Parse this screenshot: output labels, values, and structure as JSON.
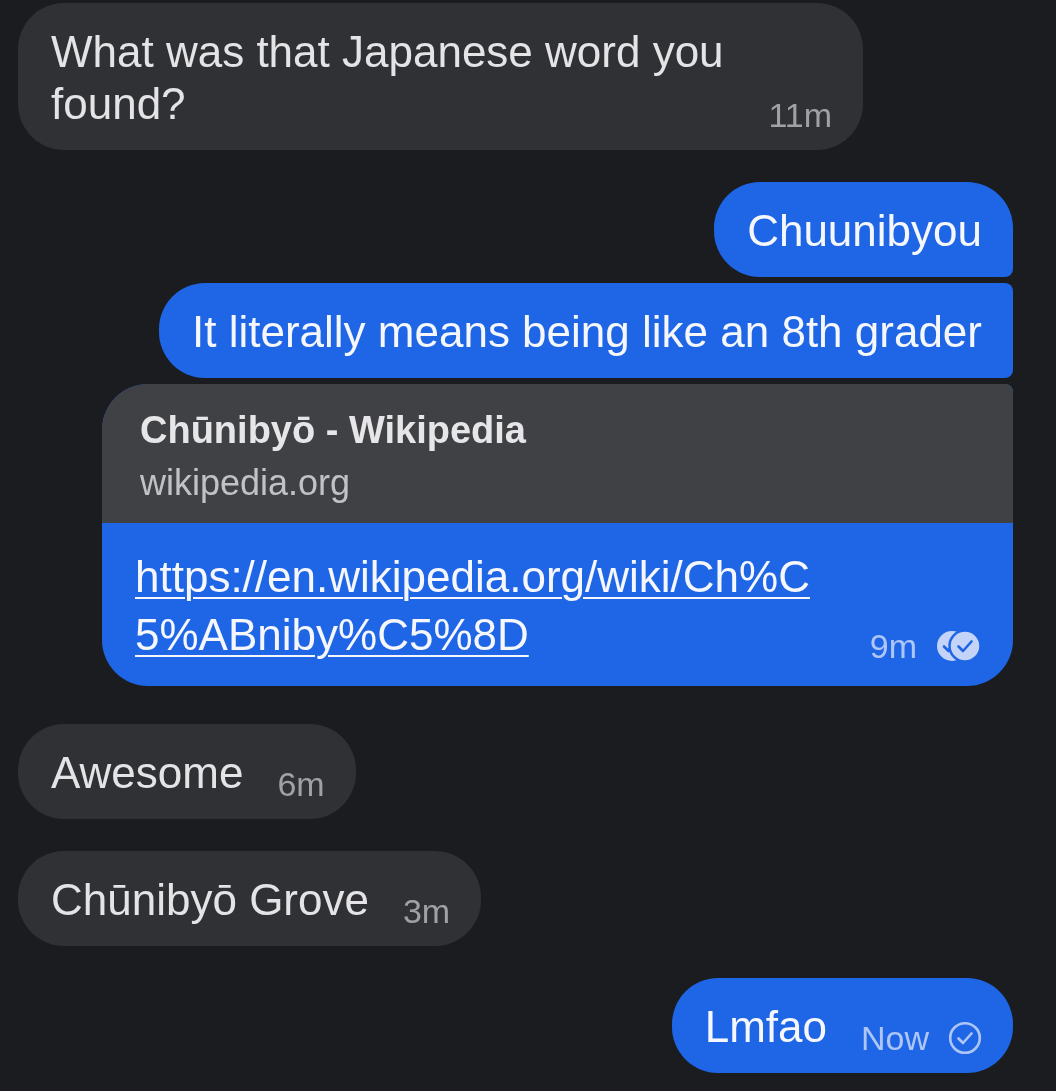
{
  "messages": [
    {
      "kind": "text",
      "outgoing": false,
      "text": "What was that Japanese word you found?",
      "time": "11m"
    },
    {
      "kind": "text",
      "outgoing": true,
      "text": "Chuunibyou"
    },
    {
      "kind": "text",
      "outgoing": true,
      "text": "It literally means being like an 8th grader"
    },
    {
      "kind": "link",
      "outgoing": true,
      "title": "Chūnibyō - Wikipedia",
      "domain": "wikipedia.org",
      "url": "https://en.wikipedia.org/wiki/Ch%C5%ABniby%C5%8D",
      "time": "9m",
      "read": true
    },
    {
      "kind": "text",
      "outgoing": false,
      "text": "Awesome",
      "time": "6m"
    },
    {
      "kind": "text",
      "outgoing": false,
      "text": "Chūnibyō Grove",
      "time": "3m"
    },
    {
      "kind": "text",
      "outgoing": true,
      "text": "Lmfao",
      "time": "Now",
      "read": false
    }
  ]
}
